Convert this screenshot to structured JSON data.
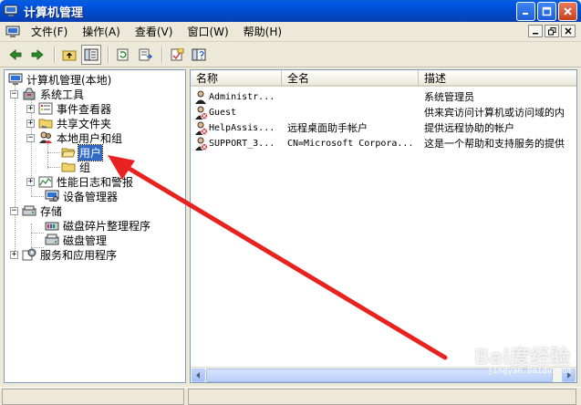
{
  "window": {
    "title": "计算机管理",
    "accent": "#0054e3",
    "selection_color": "#316ac5",
    "arrow_color": "#e8231f"
  },
  "menu": {
    "items": [
      {
        "label": "文件(F)"
      },
      {
        "label": "操作(A)"
      },
      {
        "label": "查看(V)"
      },
      {
        "label": "窗口(W)"
      },
      {
        "label": "帮助(H)"
      }
    ]
  },
  "toolbar": {
    "icons": [
      "back-icon",
      "forward-icon",
      "up-folder-icon",
      "show-tree-icon",
      "refresh-icon",
      "export-icon",
      "properties-icon",
      "help-icon"
    ]
  },
  "tree": {
    "root": "计算机管理(本地)",
    "system_tools": "系统工具",
    "event_viewer": "事件查看器",
    "shared_folders": "共享文件夹",
    "local_users_groups": "本地用户和组",
    "users": "用户",
    "groups": "组",
    "perf_logs": "性能日志和警报",
    "device_manager": "设备管理器",
    "storage": "存储",
    "defrag": "磁盘碎片整理程序",
    "disk_mgmt": "磁盘管理",
    "services_apps": "服务和应用程序"
  },
  "list": {
    "columns": {
      "name": "名称",
      "full_name": "全名",
      "description": "描述"
    },
    "rows": [
      {
        "name": "Administr...",
        "full_name": "",
        "description": "系统管理员",
        "disabled": false
      },
      {
        "name": "Guest",
        "full_name": "",
        "description": "供来宾访问计算机或访问域的内",
        "disabled": true
      },
      {
        "name": "HelpAssis...",
        "full_name": "远程桌面助手帐户",
        "description": "提供远程协助的帐户",
        "disabled": true
      },
      {
        "name": "SUPPORT_3...",
        "full_name": "CN=Microsoft Corpora...",
        "description": "这是一个帮助和支持服务的提供",
        "disabled": true
      }
    ]
  },
  "watermark": {
    "text": "Bai度经验",
    "sub": "jingyan.baidu.com"
  }
}
